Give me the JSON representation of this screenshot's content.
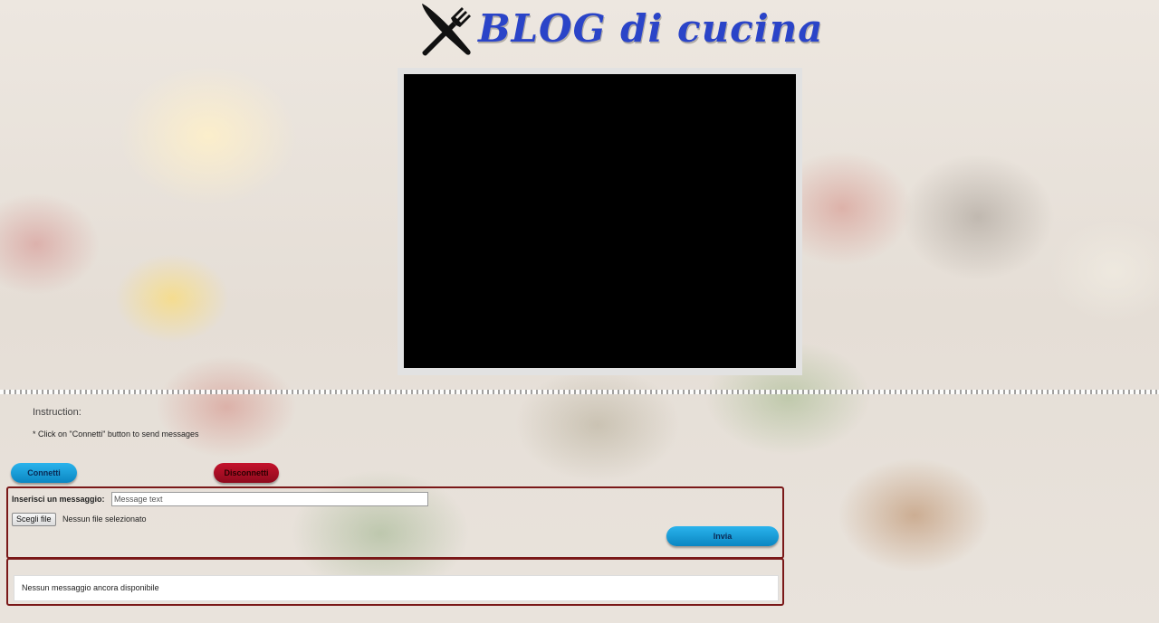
{
  "header": {
    "logo_icon": "fork-knife-cross-icon",
    "title": "BLOG di cucina"
  },
  "video": {
    "state": "black-empty"
  },
  "instructions": {
    "title": "Instruction:",
    "text": "* Click on \"Connetti\" button to send messages"
  },
  "controls": {
    "connect_label": "Connetti",
    "disconnect_label": "Disconnetti"
  },
  "send_form": {
    "message_label": "Inserisci un messaggio:",
    "message_placeholder": "Message text",
    "message_value": "",
    "file_button_label": "Scegli file",
    "file_status": "Nessun file selezionato",
    "send_label": "Invia"
  },
  "messages": {
    "empty_text": "Nessun messaggio ancora disponibile"
  },
  "colors": {
    "title": "#2a44c8",
    "primary_button": "#0b86c2",
    "danger_button": "#8e0a1d",
    "panel_border": "#7a1818"
  }
}
